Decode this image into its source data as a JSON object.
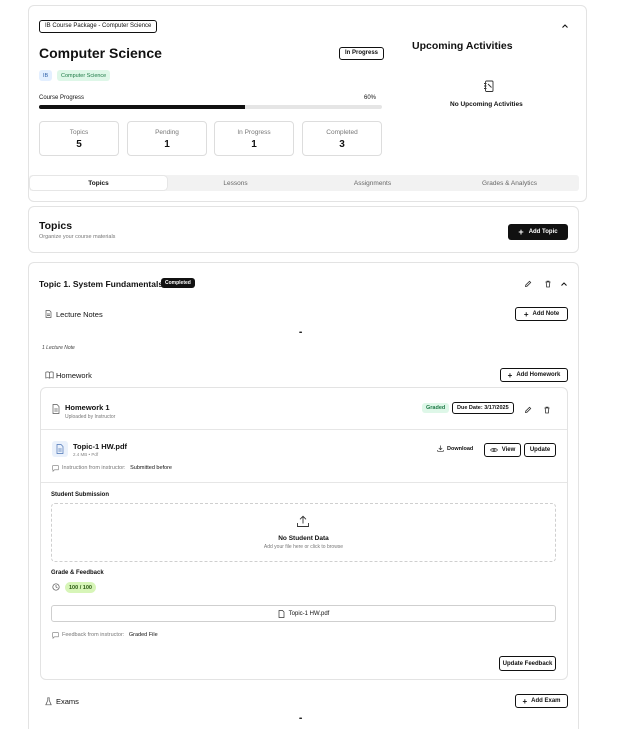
{
  "course": {
    "package_label": "IB Course Package - Computer Science",
    "title": "Computer Science",
    "status": "In Progress",
    "tags": [
      "IB",
      "Computer Science"
    ],
    "progress_label": "Course Progress",
    "progress_percent_text": "60%",
    "progress_value": 60
  },
  "stats": [
    {
      "label": "Topics",
      "value": "5"
    },
    {
      "label": "Pending",
      "value": "1"
    },
    {
      "label": "In Progress",
      "value": "1"
    },
    {
      "label": "Completed",
      "value": "3"
    }
  ],
  "upcoming": {
    "title": "Upcoming Activities",
    "empty_text": "No Upcoming Activities"
  },
  "tabs": [
    "Topics",
    "Lessons",
    "Assignments",
    "Grades & Analytics"
  ],
  "topics_header": {
    "title": "Topics",
    "subtitle": "Organize your course materials",
    "add_button": "Add Topic"
  },
  "topic": {
    "title": "Topic 1. System Fundamentals",
    "badge": "Completed",
    "lecture": {
      "title": "Lecture Notes",
      "add_button": "Add Note",
      "more": "•••",
      "count_text": "1 Lecture Note"
    },
    "homework": {
      "section_title": "Homework",
      "add_button": "Add Homework",
      "item_title": "Homework 1",
      "uploaded_by": "Uploaded by Instructor",
      "graded_badge": "Graded",
      "due_date": "Due Date: 3/17/2025",
      "file_name": "Topic-1 HW.pdf",
      "file_meta": "2.4 MB • Pdf",
      "download": "Download",
      "view": "View",
      "update": "Update",
      "instruction_label": "Instruction from instructor:",
      "instruction_value": "Submitted before",
      "submission_title": "Student Submission",
      "no_data": "No Student Data",
      "upload_hint": "Add your file here or click to browse",
      "grade_title": "Grade & Feedback",
      "grade_value": "100 / 100",
      "graded_file": "Topic-1 HW.pdf",
      "feedback_label": "Feedback from instructor:",
      "feedback_value": "Graded File",
      "update_feedback": "Update Feedback"
    },
    "exams": {
      "title": "Exams",
      "add_button": "Add Exam",
      "more": "•••"
    }
  }
}
